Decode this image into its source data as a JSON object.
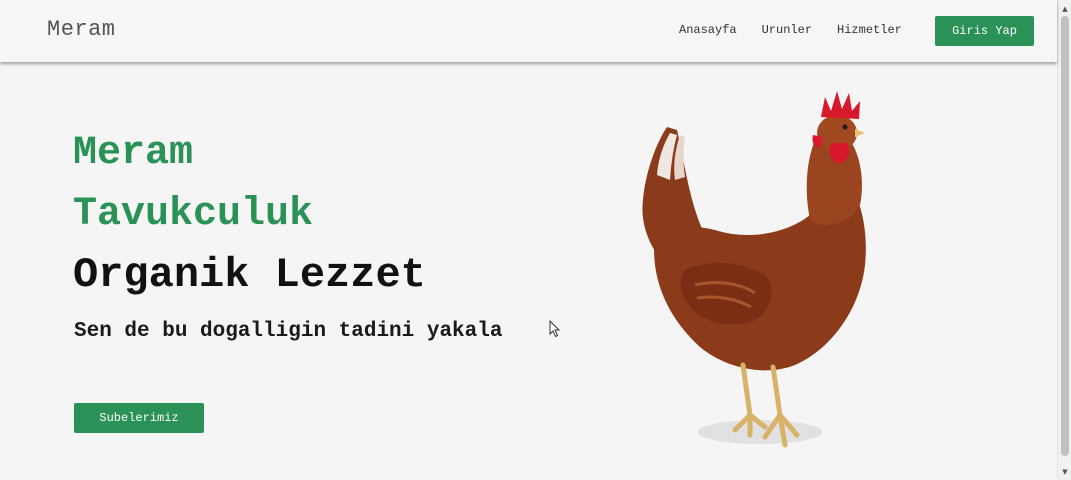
{
  "navbar": {
    "brand": "Meram",
    "links": [
      "Anasayfa",
      "Urunler",
      "Hizmetler"
    ],
    "login_label": "Giris Yap"
  },
  "hero": {
    "line1": "Meram",
    "line2": "Tavukculuk",
    "line3": "Organik Lezzet",
    "tagline": "Sen de bu dogalligin tadini yakala",
    "button_label": "Subelerimiz"
  },
  "colors": {
    "accent": "#2b9257",
    "background": "#f6f5f5",
    "heading_dark": "#111111"
  },
  "icons": {
    "hero_image": "rooster-illustration",
    "cursor": "mouse-pointer-icon",
    "scroll_up": "chevron-up-icon",
    "scroll_down": "chevron-down-icon"
  }
}
